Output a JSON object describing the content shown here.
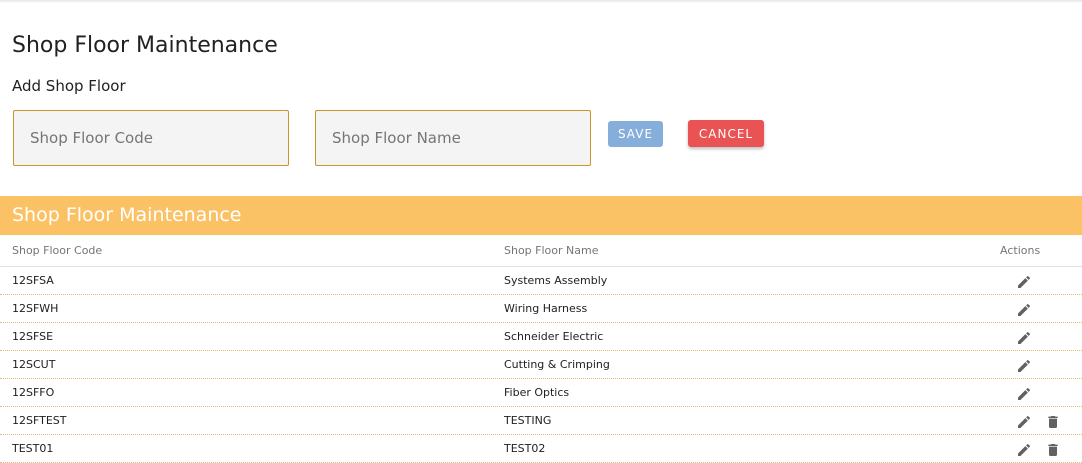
{
  "page": {
    "title": "Shop Floor Maintenance",
    "subtitle": "Add Shop Floor"
  },
  "form": {
    "code_placeholder": "Shop Floor Code",
    "code_value": "",
    "name_placeholder": "Shop Floor Name",
    "name_value": "",
    "save_label": "SAVE",
    "cancel_label": "CANCEL"
  },
  "table": {
    "title": "Shop Floor Maintenance",
    "headers": {
      "code": "Shop Floor Code",
      "name": "Shop Floor Name",
      "actions": "Actions"
    },
    "rows": [
      {
        "code": "12SFSA",
        "name": "Systems Assembly",
        "actions": [
          "edit-icon"
        ]
      },
      {
        "code": "12SFWH",
        "name": "Wiring Harness",
        "actions": [
          "edit-icon"
        ]
      },
      {
        "code": "12SFSE",
        "name": "Schneider Electric",
        "actions": [
          "edit-icon"
        ]
      },
      {
        "code": "12SCUT",
        "name": "Cutting & Crimping",
        "actions": [
          "edit-icon"
        ]
      },
      {
        "code": "12SFFO",
        "name": "Fiber Optics",
        "actions": [
          "edit-icon"
        ]
      },
      {
        "code": "12SFTEST",
        "name": "TESTING",
        "actions": [
          "edit-icon",
          "delete-icon"
        ]
      },
      {
        "code": "TEST01",
        "name": "TEST02",
        "actions": [
          "edit-icon",
          "delete-icon"
        ]
      }
    ]
  },
  "colors": {
    "accent_band": "#fbc265",
    "field_border": "#c8962c",
    "save_button": "#85aedb",
    "cancel_button": "#e95353",
    "icon": "#616161"
  }
}
